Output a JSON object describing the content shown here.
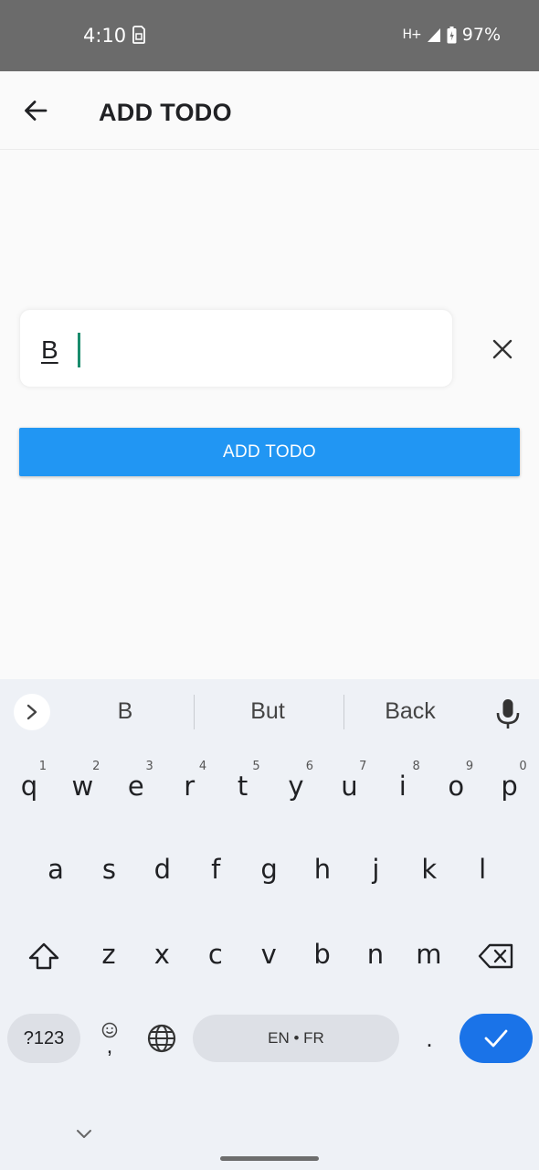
{
  "status_bar": {
    "time": "4:10",
    "network": "H+",
    "battery": "97%"
  },
  "app_bar": {
    "title": "ADD TODO",
    "back_icon": "arrow-back-icon"
  },
  "form": {
    "input_value": "B",
    "clear_icon": "close-icon",
    "add_button_label": "ADD TODO",
    "accent_color": "#2196f3"
  },
  "keyboard": {
    "suggestions": [
      "B",
      "But",
      "Back"
    ],
    "row1": [
      {
        "key": "q",
        "hint": "1"
      },
      {
        "key": "w",
        "hint": "2"
      },
      {
        "key": "e",
        "hint": "3"
      },
      {
        "key": "r",
        "hint": "4"
      },
      {
        "key": "t",
        "hint": "5"
      },
      {
        "key": "y",
        "hint": "6"
      },
      {
        "key": "u",
        "hint": "7"
      },
      {
        "key": "i",
        "hint": "8"
      },
      {
        "key": "o",
        "hint": "9"
      },
      {
        "key": "p",
        "hint": "0"
      }
    ],
    "row2": [
      "a",
      "s",
      "d",
      "f",
      "g",
      "h",
      "j",
      "k",
      "l"
    ],
    "row3": [
      "z",
      "x",
      "c",
      "v",
      "b",
      "n",
      "m"
    ],
    "symbols_label": "?123",
    "comma_label": ",",
    "space_label": "EN • FR",
    "period_label": ".",
    "enter_color": "#1a73e8"
  }
}
